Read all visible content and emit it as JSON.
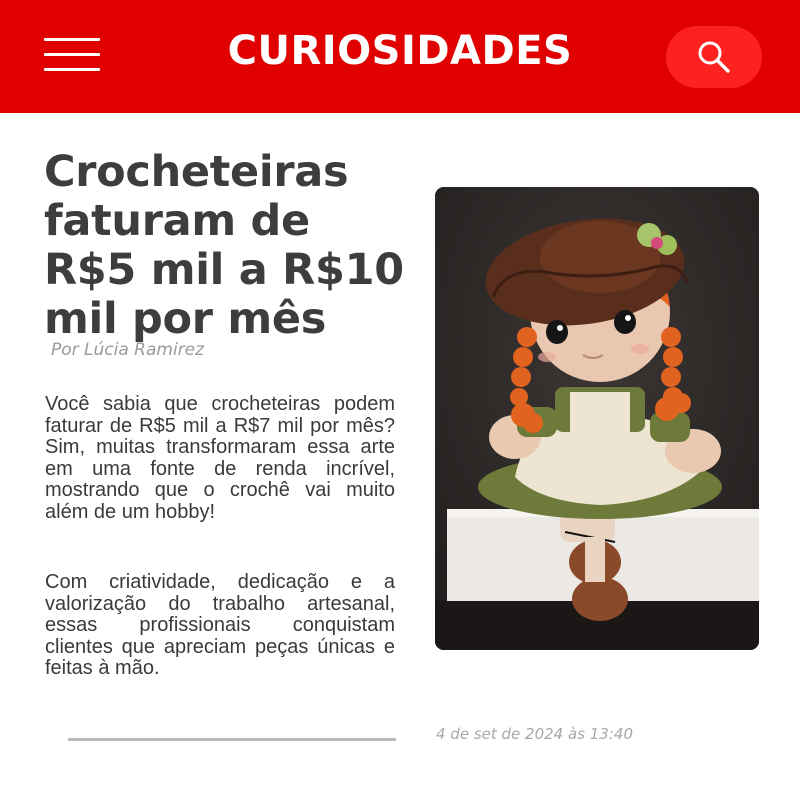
{
  "header": {
    "title": "CURIOSIDADES",
    "menu_icon": "hamburger-menu-icon",
    "search_icon": "search-icon",
    "background_color": "#e00000",
    "search_button_color": "#ff2020"
  },
  "article": {
    "headline": "Crocheteiras faturam de R$5 mil a R$10 mil por mês",
    "byline": "Por Lúcia Ramirez",
    "paragraphs": [
      "Você sabia que crocheteiras podem faturar de R$5 mil a R$7 mil por mês? Sim, muitas transformaram essa arte em uma fonte de renda incrível, mostrando que o crochê vai muito além de um hobby!",
      "Com criatividade, dedicação e a valorização do trabalho artesanal, essas profissionais conquistam clientes que apreciam peças únicas e feitas à mão."
    ],
    "timestamp": "4 de set de 2024 às 13:40"
  }
}
